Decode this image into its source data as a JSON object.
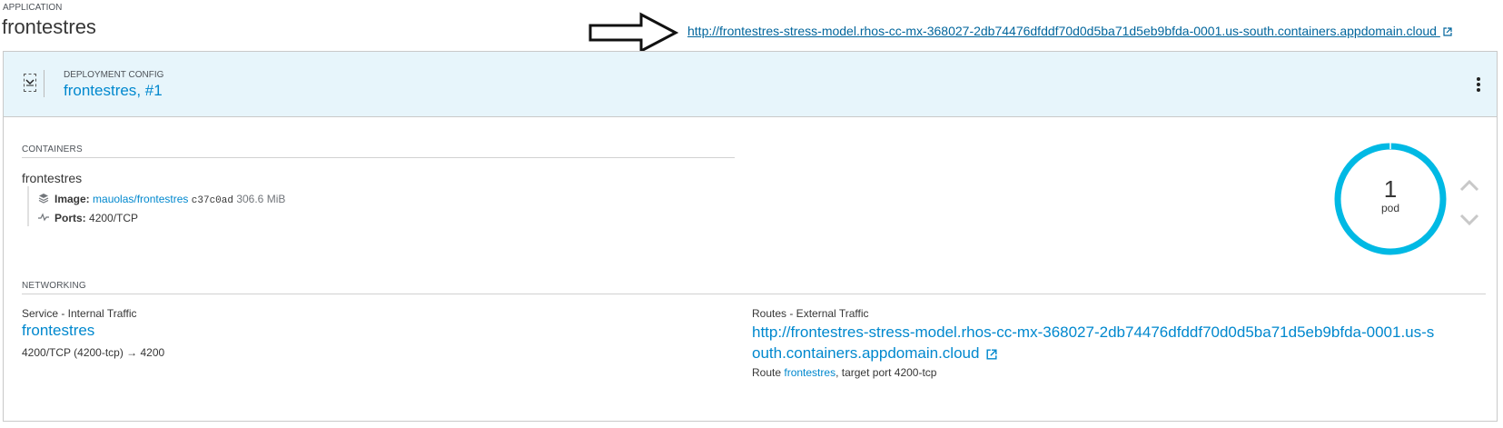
{
  "application": {
    "label": "APPLICATION",
    "name": "frontestres",
    "route_url": "http://frontestres-stress-model.rhos-cc-mx-368027-2db74476dfddf70d0d5ba71d5eb9bfda-0001.us-south.containers.appdomain.cloud"
  },
  "deployment": {
    "label": "DEPLOYMENT CONFIG",
    "name": "frontestres",
    "separator": ",",
    "revision": "#1"
  },
  "containers": {
    "label": "CONTAINERS",
    "name": "frontestres",
    "image_label": "Image:",
    "image_name": "mauolas/frontestres",
    "image_id": "c37c0ad",
    "image_size": "306.6 MiB",
    "ports_label": "Ports:",
    "ports_value": "4200/TCP"
  },
  "pods": {
    "count": "1",
    "label": "pod"
  },
  "networking": {
    "label": "NETWORKING",
    "service_heading": "Service - Internal Traffic",
    "service_name": "frontestres",
    "service_port": "4200/TCP (4200-tcp) → 4200",
    "routes_heading": "Routes - External Traffic",
    "route_url": "http://frontestres-stress-model.rhos-cc-mx-368027-2db74476dfddf70d0d5ba71d5eb9bfda-0001.us-south.containers.appdomain.cloud",
    "route_prefix": "Route",
    "route_name": "frontestres",
    "route_suffix": ", target port 4200-tcp"
  },
  "colors": {
    "link": "#0088ce",
    "header_bg": "#e7f5fb",
    "donut": "#00b9e4"
  },
  "icons": [
    "external-link-icon",
    "expand-toggle-icon",
    "kebab-menu-icon",
    "image-layers-icon",
    "ports-pulse-icon",
    "chevron-up-icon",
    "chevron-down-icon",
    "annotation-arrow"
  ]
}
